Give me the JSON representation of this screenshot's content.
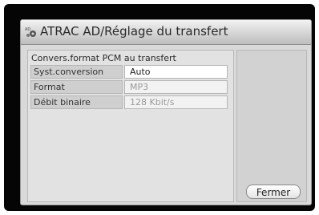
{
  "window": {
    "title": "ATRAC AD/Réglage du transfert",
    "title_icon": "atrac-ad-icon",
    "accent": "#d9d9d9"
  },
  "content": {
    "section_label": "Convers.format PCM au transfert",
    "rows": [
      {
        "label": "Syst.conversion",
        "value": "Auto",
        "state": "active"
      },
      {
        "label": "Format",
        "value": "MP3",
        "state": "disabled"
      },
      {
        "label": "Débit binaire",
        "value": "128 Kbit/s",
        "state": "disabled"
      }
    ]
  },
  "buttons": {
    "close_label": "Fermer"
  }
}
